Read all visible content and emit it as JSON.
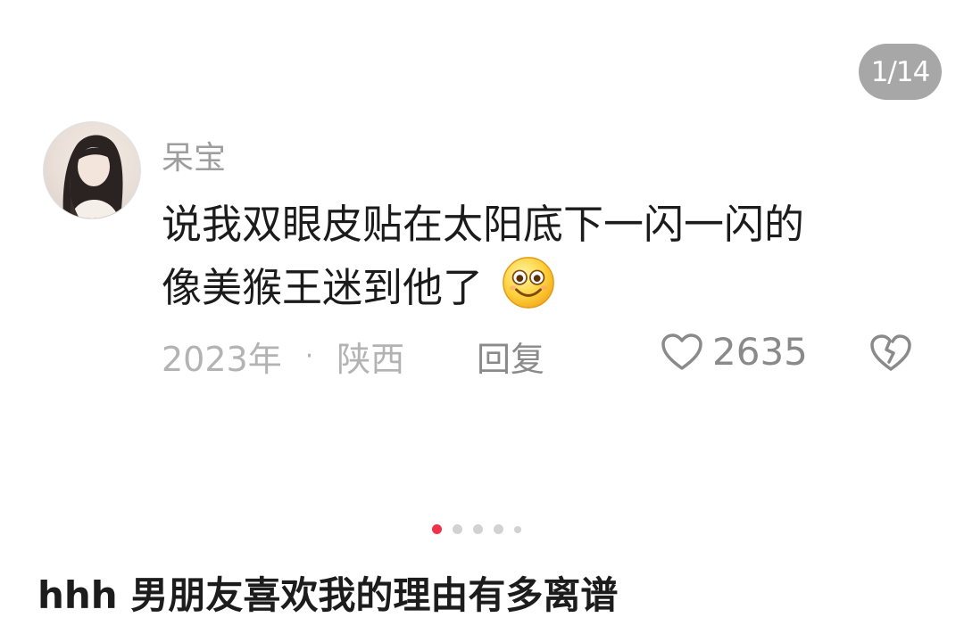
{
  "counter": "1/14",
  "comment": {
    "username": "呆宝",
    "line1": "说我双眼皮贴在太阳底下一闪一闪的",
    "line2": "像美猴王迷到他了",
    "emoji_icon": "smiling-emoji-icon",
    "year": "2023年",
    "separator": "·",
    "location": "陕西",
    "reply_label": "回复",
    "like_count": "2635"
  },
  "carousel": {
    "total_dots": 5,
    "active_index": 0
  },
  "caption": "hhh 男朋友喜欢我的理由有多离谱",
  "colors": {
    "accent": "#f0314a",
    "muted": "#b3b3b3"
  }
}
